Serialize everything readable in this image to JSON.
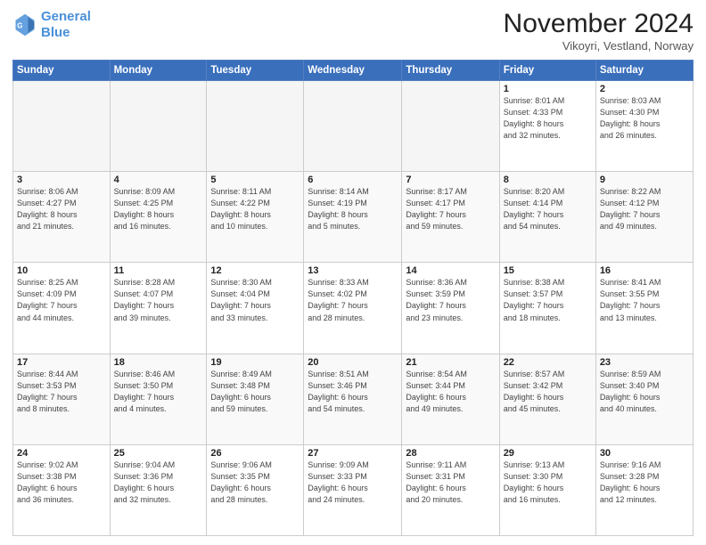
{
  "header": {
    "logo_line1": "General",
    "logo_line2": "Blue",
    "month": "November 2024",
    "location": "Vikoyri, Vestland, Norway"
  },
  "days_of_week": [
    "Sunday",
    "Monday",
    "Tuesday",
    "Wednesday",
    "Thursday",
    "Friday",
    "Saturday"
  ],
  "weeks": [
    [
      {
        "day": "",
        "info": ""
      },
      {
        "day": "",
        "info": ""
      },
      {
        "day": "",
        "info": ""
      },
      {
        "day": "",
        "info": ""
      },
      {
        "day": "",
        "info": ""
      },
      {
        "day": "1",
        "info": "Sunrise: 8:01 AM\nSunset: 4:33 PM\nDaylight: 8 hours\nand 32 minutes."
      },
      {
        "day": "2",
        "info": "Sunrise: 8:03 AM\nSunset: 4:30 PM\nDaylight: 8 hours\nand 26 minutes."
      }
    ],
    [
      {
        "day": "3",
        "info": "Sunrise: 8:06 AM\nSunset: 4:27 PM\nDaylight: 8 hours\nand 21 minutes."
      },
      {
        "day": "4",
        "info": "Sunrise: 8:09 AM\nSunset: 4:25 PM\nDaylight: 8 hours\nand 16 minutes."
      },
      {
        "day": "5",
        "info": "Sunrise: 8:11 AM\nSunset: 4:22 PM\nDaylight: 8 hours\nand 10 minutes."
      },
      {
        "day": "6",
        "info": "Sunrise: 8:14 AM\nSunset: 4:19 PM\nDaylight: 8 hours\nand 5 minutes."
      },
      {
        "day": "7",
        "info": "Sunrise: 8:17 AM\nSunset: 4:17 PM\nDaylight: 7 hours\nand 59 minutes."
      },
      {
        "day": "8",
        "info": "Sunrise: 8:20 AM\nSunset: 4:14 PM\nDaylight: 7 hours\nand 54 minutes."
      },
      {
        "day": "9",
        "info": "Sunrise: 8:22 AM\nSunset: 4:12 PM\nDaylight: 7 hours\nand 49 minutes."
      }
    ],
    [
      {
        "day": "10",
        "info": "Sunrise: 8:25 AM\nSunset: 4:09 PM\nDaylight: 7 hours\nand 44 minutes."
      },
      {
        "day": "11",
        "info": "Sunrise: 8:28 AM\nSunset: 4:07 PM\nDaylight: 7 hours\nand 39 minutes."
      },
      {
        "day": "12",
        "info": "Sunrise: 8:30 AM\nSunset: 4:04 PM\nDaylight: 7 hours\nand 33 minutes."
      },
      {
        "day": "13",
        "info": "Sunrise: 8:33 AM\nSunset: 4:02 PM\nDaylight: 7 hours\nand 28 minutes."
      },
      {
        "day": "14",
        "info": "Sunrise: 8:36 AM\nSunset: 3:59 PM\nDaylight: 7 hours\nand 23 minutes."
      },
      {
        "day": "15",
        "info": "Sunrise: 8:38 AM\nSunset: 3:57 PM\nDaylight: 7 hours\nand 18 minutes."
      },
      {
        "day": "16",
        "info": "Sunrise: 8:41 AM\nSunset: 3:55 PM\nDaylight: 7 hours\nand 13 minutes."
      }
    ],
    [
      {
        "day": "17",
        "info": "Sunrise: 8:44 AM\nSunset: 3:53 PM\nDaylight: 7 hours\nand 8 minutes."
      },
      {
        "day": "18",
        "info": "Sunrise: 8:46 AM\nSunset: 3:50 PM\nDaylight: 7 hours\nand 4 minutes."
      },
      {
        "day": "19",
        "info": "Sunrise: 8:49 AM\nSunset: 3:48 PM\nDaylight: 6 hours\nand 59 minutes."
      },
      {
        "day": "20",
        "info": "Sunrise: 8:51 AM\nSunset: 3:46 PM\nDaylight: 6 hours\nand 54 minutes."
      },
      {
        "day": "21",
        "info": "Sunrise: 8:54 AM\nSunset: 3:44 PM\nDaylight: 6 hours\nand 49 minutes."
      },
      {
        "day": "22",
        "info": "Sunrise: 8:57 AM\nSunset: 3:42 PM\nDaylight: 6 hours\nand 45 minutes."
      },
      {
        "day": "23",
        "info": "Sunrise: 8:59 AM\nSunset: 3:40 PM\nDaylight: 6 hours\nand 40 minutes."
      }
    ],
    [
      {
        "day": "24",
        "info": "Sunrise: 9:02 AM\nSunset: 3:38 PM\nDaylight: 6 hours\nand 36 minutes."
      },
      {
        "day": "25",
        "info": "Sunrise: 9:04 AM\nSunset: 3:36 PM\nDaylight: 6 hours\nand 32 minutes."
      },
      {
        "day": "26",
        "info": "Sunrise: 9:06 AM\nSunset: 3:35 PM\nDaylight: 6 hours\nand 28 minutes."
      },
      {
        "day": "27",
        "info": "Sunrise: 9:09 AM\nSunset: 3:33 PM\nDaylight: 6 hours\nand 24 minutes."
      },
      {
        "day": "28",
        "info": "Sunrise: 9:11 AM\nSunset: 3:31 PM\nDaylight: 6 hours\nand 20 minutes."
      },
      {
        "day": "29",
        "info": "Sunrise: 9:13 AM\nSunset: 3:30 PM\nDaylight: 6 hours\nand 16 minutes."
      },
      {
        "day": "30",
        "info": "Sunrise: 9:16 AM\nSunset: 3:28 PM\nDaylight: 6 hours\nand 12 minutes."
      }
    ]
  ]
}
